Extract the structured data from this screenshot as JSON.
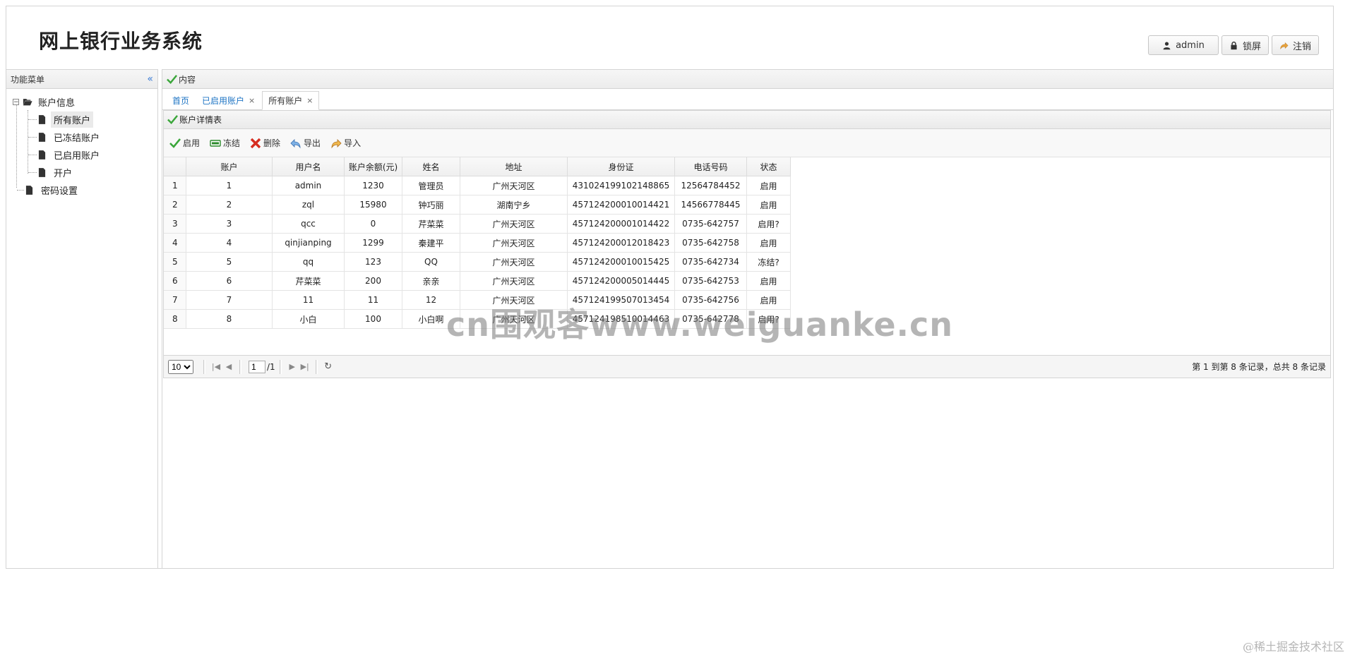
{
  "header": {
    "title": "网上银行业务系统",
    "buttons": {
      "admin": "admin",
      "lock": "锁屏",
      "logout": "注销"
    }
  },
  "west": {
    "title": "功能菜单",
    "tree": {
      "root": "账户信息",
      "children": [
        "所有账户",
        "已冻结账户",
        "已启用账户",
        "开户"
      ],
      "password": "密码设置"
    }
  },
  "center": {
    "title": "内容",
    "tabs": [
      {
        "label": "首页"
      },
      {
        "label": "已启用账户",
        "close": "×"
      },
      {
        "label": "所有账户",
        "close": "×"
      }
    ],
    "panel_title": "账户详情表",
    "toolbar": {
      "enable": "启用",
      "freeze": "冻结",
      "delete": "删除",
      "export": "导出",
      "import": "导入"
    },
    "table": {
      "columns": [
        "账户",
        "用户名",
        "账户余额(元)",
        "姓名",
        "地址",
        "身份证",
        "电话号码",
        "状态"
      ],
      "rows": [
        [
          "1",
          "1",
          "admin",
          "1230",
          "管理员",
          "广州天河区",
          "431024199102148865",
          "12564784452",
          "启用"
        ],
        [
          "2",
          "2",
          "zql",
          "15980",
          "钟巧丽",
          "湖南宁乡",
          "457124200010014421",
          "14566778445",
          "启用"
        ],
        [
          "3",
          "3",
          "qcc",
          "0",
          "芹菜菜",
          "广州天河区",
          "457124200001014422",
          "0735-642757",
          "启用?"
        ],
        [
          "4",
          "4",
          "qinjianping",
          "1299",
          "秦建平",
          "广州天河区",
          "457124200012018423",
          "0735-642758",
          "启用"
        ],
        [
          "5",
          "5",
          "qq",
          "123",
          "QQ",
          "广州天河区",
          "457124200010015425",
          "0735-642734",
          "冻结?"
        ],
        [
          "6",
          "6",
          "芹菜菜",
          "200",
          "亲亲",
          "广州天河区",
          "457124200005014445",
          "0735-642753",
          "启用"
        ],
        [
          "7",
          "7",
          "11",
          "11",
          "12",
          "广州天河区",
          "457124199507013454",
          "0735-642756",
          "启用"
        ],
        [
          "8",
          "8",
          "小白",
          "100",
          "小白啊",
          "广州天河区",
          "457124198510014463",
          "0735-642778",
          "启用?"
        ]
      ]
    },
    "pager": {
      "page_size": "10",
      "page": "1",
      "total_pages": "/1",
      "info": "第 1 到第 8 条记录，总共 8 条记录"
    }
  },
  "watermark": "cn围观客www.weiguanke.cn",
  "credit": "@稀土掘金技术社区",
  "colors": {
    "link": "#1e74c4",
    "accent_green": "#3aa63a",
    "delete_red": "#d62d20"
  }
}
